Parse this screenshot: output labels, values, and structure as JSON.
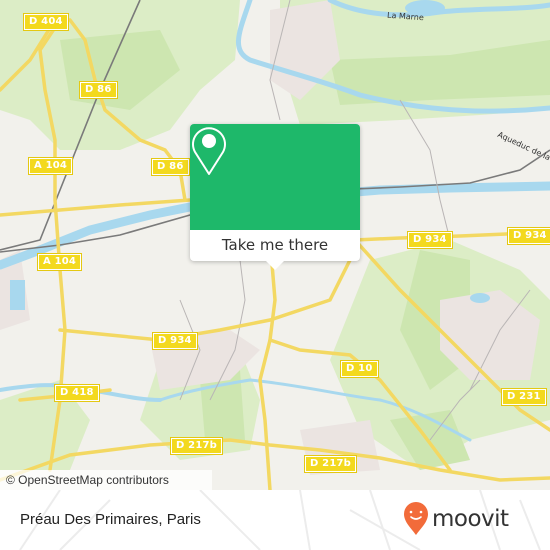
{
  "map": {
    "road_labels": [
      {
        "id": "d404",
        "text": "D 404"
      },
      {
        "id": "d86-a",
        "text": "D 86"
      },
      {
        "id": "a104-a",
        "text": "A 104"
      },
      {
        "id": "d86-b",
        "text": "D 86"
      },
      {
        "id": "a104-b",
        "text": "A 104"
      },
      {
        "id": "d934-a",
        "text": "D 934"
      },
      {
        "id": "d934-b",
        "text": "D 934"
      },
      {
        "id": "d934-c",
        "text": "D 934"
      },
      {
        "id": "d418",
        "text": "D 418"
      },
      {
        "id": "d10",
        "text": "D 10"
      },
      {
        "id": "d231",
        "text": "D 231"
      },
      {
        "id": "d217b-a",
        "text": "D 217b"
      },
      {
        "id": "d217b-b",
        "text": "D 217b"
      }
    ],
    "water_labels": {
      "marne": "La Marne",
      "aqueduc": "Aqueduc de la"
    },
    "attribution": "© OpenStreetMap contributors",
    "colors": {
      "land": "#f2f1ec",
      "forest": "#d9ecc0",
      "forest_dark": "#cbe5ad",
      "water": "#a8d8ee",
      "urban": "#ebe4e2",
      "road_major": "#f5dd5a",
      "rail": "#777777"
    }
  },
  "popup": {
    "action_label": "Take me there",
    "icon": "map-pin-icon",
    "color": "#1eb86a"
  },
  "footer": {
    "place_name": "Préau Des Primaires, Paris",
    "brand": "moovit",
    "brand_color": "#f26b3a"
  }
}
